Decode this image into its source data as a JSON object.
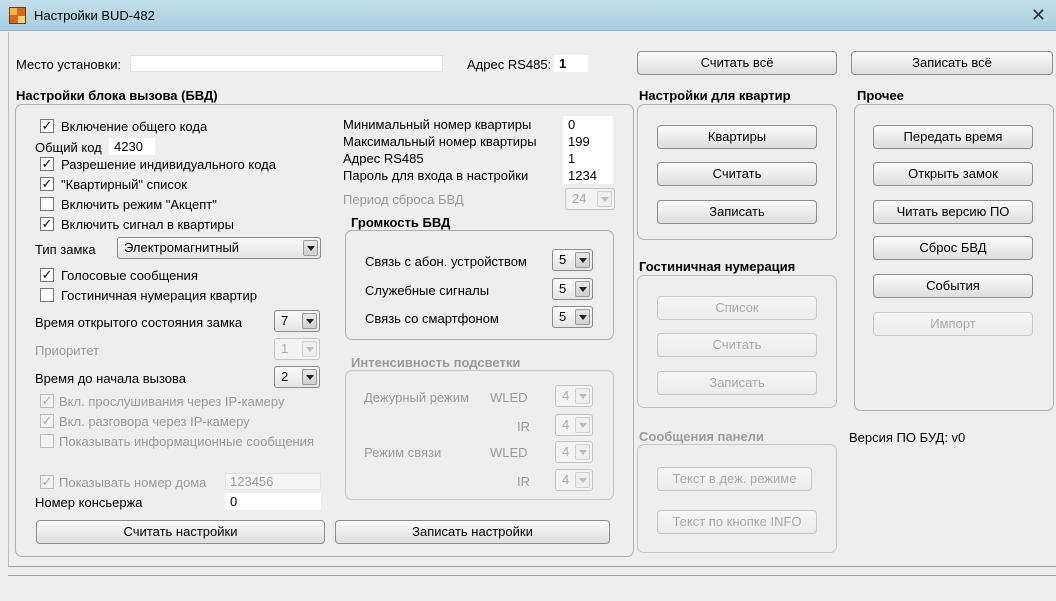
{
  "window": {
    "title": "Настройки BUD-482",
    "close_glyph": "✕"
  },
  "top": {
    "location_label": "Место установки:",
    "location_value": "",
    "rs485_label": "Адрес RS485:",
    "rs485_value": "1",
    "read_all": "Считать всё",
    "write_all": "Записать всё"
  },
  "bvd": {
    "title": "Настройки блока вызова (БВД)",
    "common_code_enable": "Включение общего кода",
    "common_code_label": "Общий код",
    "common_code_value": "4230",
    "individual_code": "Разрешение индивидуального кода",
    "apartment_list": "\"Квартирный\" список",
    "accent_mode": "Включить режим \"Акцепт\"",
    "signal_to_apartments": "Включить сигнал в квартиры",
    "lock_type_label": "Тип замка",
    "lock_type_value": "Электромагнитный",
    "voice_messages": "Голосовые сообщения",
    "hotel_numbering": "Гостиничная нумерация квартир",
    "lock_open_time_label": "Время открытого состояния замка",
    "lock_open_time_value": "7",
    "priority_label": "Приоритет",
    "priority_value": "1",
    "call_delay_label": "Время до начала вызова",
    "call_delay_value": "2",
    "ip_listen": "Вкл. прослушивания через IP-камеру",
    "ip_talk": "Вкл. разговора через IP-камеру",
    "show_info": "Показывать информационные сообщения",
    "show_house_number": "Показывать номер дома",
    "house_number_value": "123456",
    "concierge_label": "Номер консьержа",
    "concierge_value": "0",
    "read_settings": "Считать настройки",
    "write_settings": "Записать настройки",
    "min_apartment_label": "Минимальный номер квартиры",
    "min_apartment_value": "0",
    "max_apartment_label": "Максимальный номер квартиры",
    "max_apartment_value": "199",
    "rs485_label": "Адрес RS485",
    "rs485_value": "1",
    "password_label": "Пароль для входа в настройки",
    "password_value": "1234",
    "reset_period_label": "Период сброса БВД",
    "reset_period_value": "24"
  },
  "volume": {
    "title": "Громкость БВД",
    "subscriber_label": "Связь с абон. устройством",
    "subscriber_value": "5",
    "service_label": "Служебные сигналы",
    "service_value": "5",
    "smartphone_label": "Связь со смартфоном",
    "smartphone_value": "5"
  },
  "backlight": {
    "title": "Интенсивность подсветки",
    "standby_label": "Дежурный режим",
    "comm_label": "Режим связи",
    "wled": "WLED",
    "ir": "IR",
    "standby_wled": "4",
    "standby_ir": "4",
    "comm_wled": "4",
    "comm_ir": "4"
  },
  "apartments": {
    "title": "Настройки для квартир",
    "apartments_btn": "Квартиры",
    "read_btn": "Считать",
    "write_btn": "Записать"
  },
  "hotel": {
    "title": "Гостиничная нумерация",
    "list_btn": "Список",
    "read_btn": "Считать",
    "write_btn": "Записать"
  },
  "panel_messages": {
    "title": "Сообщения панели",
    "standby_text_btn": "Текст в деж. режиме",
    "info_text_btn": "Текст по кнопке INFO"
  },
  "other": {
    "title": "Прочее",
    "send_time": "Передать время",
    "open_lock": "Открыть замок",
    "read_fw": "Читать версию ПО",
    "reset_bvd": "Сброс БВД",
    "events": "События",
    "import": "Импорт",
    "fw_version": "Версия ПО БУД: v0"
  },
  "checks": {
    "common_code_enable": true,
    "individual_code": true,
    "apartment_list": true,
    "accent_mode": false,
    "signal_to_apartments": true,
    "voice_messages": true,
    "hotel_numbering": false,
    "ip_listen": true,
    "ip_talk": true,
    "show_info": false,
    "show_house_number": true
  }
}
